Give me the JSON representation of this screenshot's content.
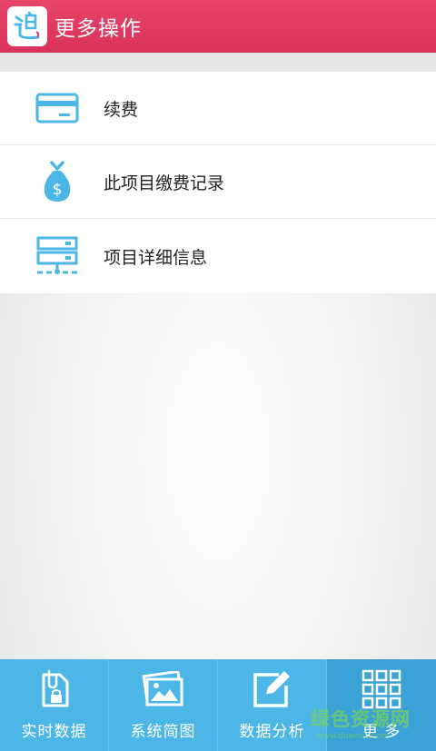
{
  "header": {
    "title": "更多操作",
    "logo_icon": "app-logo-icon",
    "color": "#e03a60"
  },
  "menu": {
    "items": [
      {
        "label": "续费",
        "icon": "card-icon"
      },
      {
        "label": "此项目缴费记录",
        "icon": "money-bag-icon"
      },
      {
        "label": "项目详细信息",
        "icon": "server-icon"
      }
    ],
    "icon_color": "#4cb6e6"
  },
  "tabbar": {
    "color": "#4cb6e6",
    "active_index": 3,
    "tabs": [
      {
        "label": "实时数据",
        "icon": "locked-document-icon"
      },
      {
        "label": "系统简图",
        "icon": "photos-icon"
      },
      {
        "label": "数据分析",
        "icon": "edit-icon"
      },
      {
        "label": "更 多",
        "icon": "grid-icon"
      }
    ]
  },
  "watermark": {
    "text": "绿色资源网",
    "sub": "www.downcc.com"
  }
}
